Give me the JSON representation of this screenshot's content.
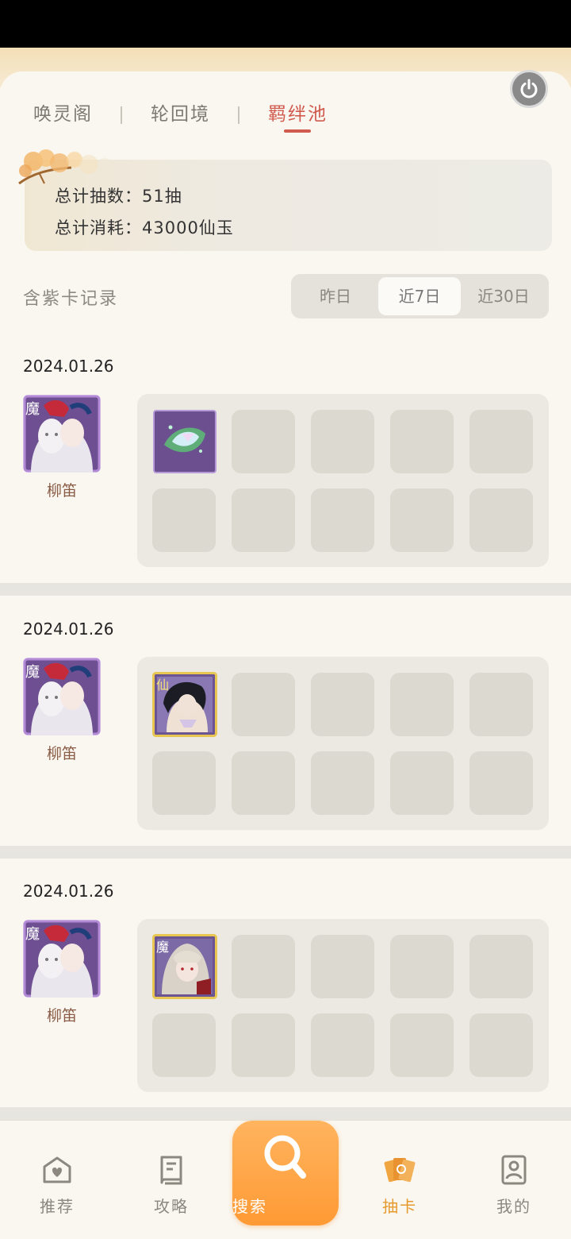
{
  "tabs": [
    {
      "label": "唤灵阁",
      "active": false
    },
    {
      "label": "轮回境",
      "active": false
    },
    {
      "label": "羁绊池",
      "active": true
    }
  ],
  "summary": {
    "total_draws": "总计抽数：51抽",
    "total_cost": "总计消耗：43000仙玉"
  },
  "section_title": "含紫卡记录",
  "range_filter": {
    "options": [
      "昨日",
      "近7日",
      "近30日"
    ],
    "selected": "近7日"
  },
  "records": [
    {
      "date": "2024.01.26",
      "character": "柳笛",
      "badge": "魔",
      "slot_items": [
        "crystal-item"
      ]
    },
    {
      "date": "2024.01.26",
      "character": "柳笛",
      "badge": "魔",
      "slot_items": [
        "character-card-xian"
      ]
    },
    {
      "date": "2024.01.26",
      "character": "柳笛",
      "badge": "魔",
      "slot_items": [
        "character-card-mo"
      ]
    }
  ],
  "nav": [
    {
      "label": "推荐",
      "icon": "heart-home-icon"
    },
    {
      "label": "攻略",
      "icon": "book-icon"
    },
    {
      "label": "搜索",
      "icon": "search-icon"
    },
    {
      "label": "抽卡",
      "icon": "cards-icon",
      "active": true
    },
    {
      "label": "我的",
      "icon": "profile-icon"
    }
  ],
  "colors": {
    "accent_red": "#d05a4e",
    "accent_orange": "#ff9a35",
    "background": "#faf7f0"
  }
}
